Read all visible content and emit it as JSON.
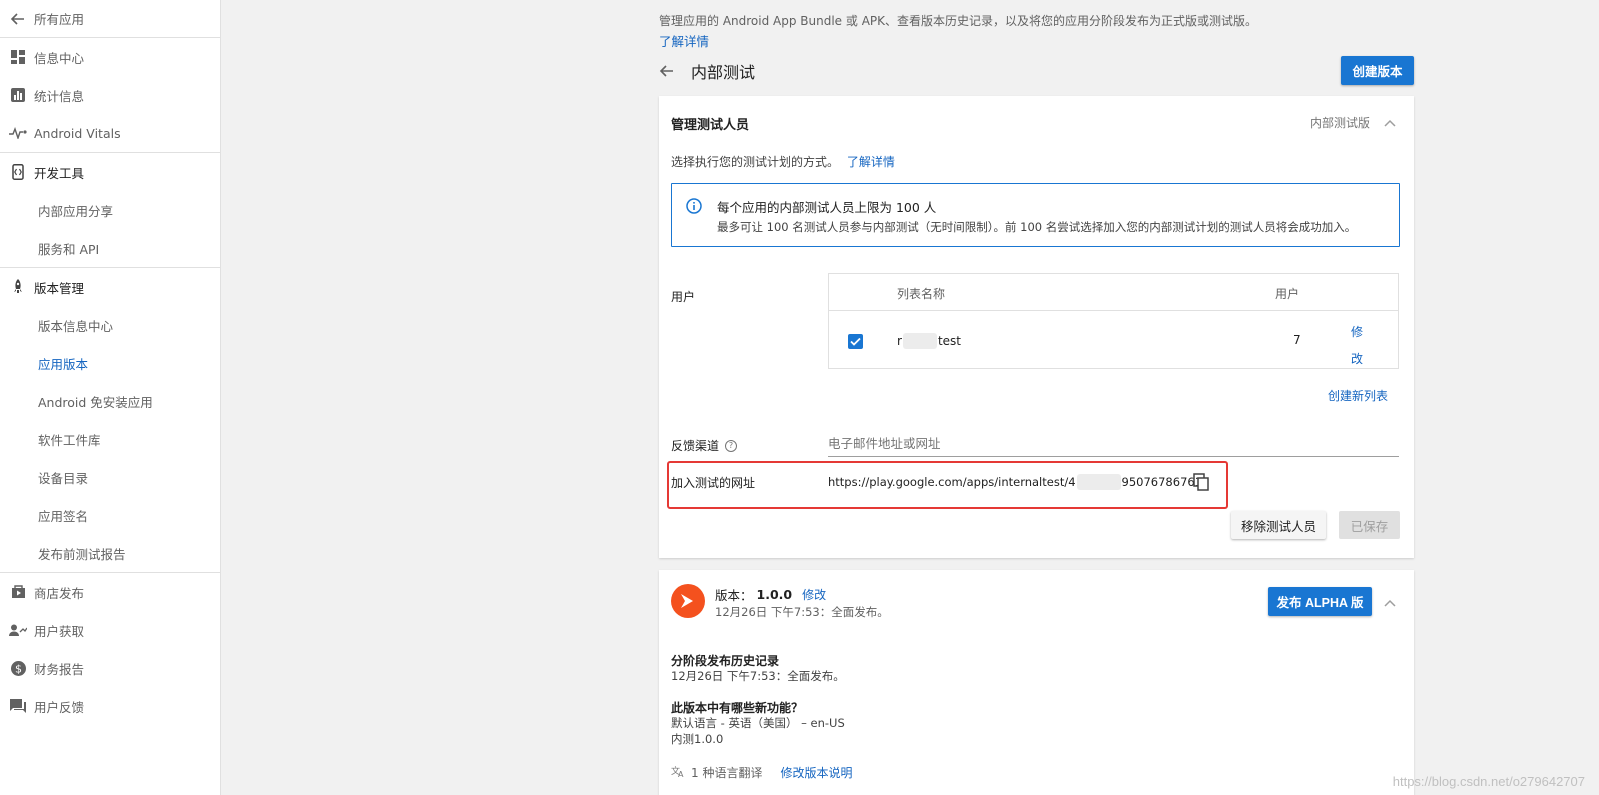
{
  "sidebar": {
    "back_label": "所有应用",
    "items": [
      {
        "label": "信息中心"
      },
      {
        "label": "统计信息"
      },
      {
        "label": "Android Vitals"
      },
      {
        "label": "开发工具"
      },
      {
        "label": "内部应用分享"
      },
      {
        "label": "服务和 API"
      },
      {
        "label": "版本管理"
      },
      {
        "label": "版本信息中心"
      },
      {
        "label": "应用版本"
      },
      {
        "label": "Android 免安装应用"
      },
      {
        "label": "软件工件库"
      },
      {
        "label": "设备目录"
      },
      {
        "label": "应用签名"
      },
      {
        "label": "发布前测试报告"
      },
      {
        "label": "商店发布"
      },
      {
        "label": "用户获取"
      },
      {
        "label": "财务报告"
      },
      {
        "label": "用户反馈"
      }
    ]
  },
  "header": {
    "intro": "管理应用的 Android App Bundle 或 APK、查看版本历史记录，以及将您的应用分阶段发布为正式版或测试版。",
    "learn_more": "了解详情",
    "title": "内部测试",
    "create_button": "创建版本"
  },
  "testers_card": {
    "title": "管理测试人员",
    "track_label": "内部测试版",
    "desc": "选择执行您的测试计划的方式。",
    "desc_link": "了解详情",
    "info_title": "每个应用的内部测试人员上限为 100 人",
    "info_text": "最多可让 100 名测试人员参与内部测试（无时间限制）。前 100 名尝试选择加入您的内部测试计划的测试人员将会成功加入。",
    "users_label": "用户",
    "table": {
      "col_name": "列表名称",
      "col_users": "用户",
      "row": {
        "name_start": "r",
        "name_end": "test",
        "count": "7",
        "edit": "修改"
      }
    },
    "create_list": "创建新列表",
    "feedback_label": "反馈渠道",
    "feedback_placeholder": "电子邮件地址或网址",
    "join_url_label": "加入测试的网址",
    "join_url_start": "https://play.google.com/apps/internaltest/4",
    "join_url_end": "95076786761",
    "remove_button": "移除测试人员",
    "saved_button": "已保存"
  },
  "release_card": {
    "version_label": "版本：",
    "version": "1.0.0",
    "edit": "修改",
    "date": "12月26日 下午7:53：全面发布。",
    "alpha_button": "发布 ALPHA 版",
    "history_title": "分阶段发布历史记录",
    "history_text": "12月26日 下午7:53：全面发布。",
    "whatsnew_title": "此版本中有哪些新功能？",
    "whatsnew_lang": "默认语言 - 英语（美国） – en-US",
    "whatsnew_text": "内测1.0.0",
    "translations": "1 种语言翻译",
    "edit_notes": "修改版本说明"
  },
  "watermark": "https://blog.csdn.net/o279642707",
  "colors": {
    "accent": "#1976d2",
    "link": "#1565c0",
    "highlight": "#e53935",
    "release_logo": "#f4511e"
  }
}
